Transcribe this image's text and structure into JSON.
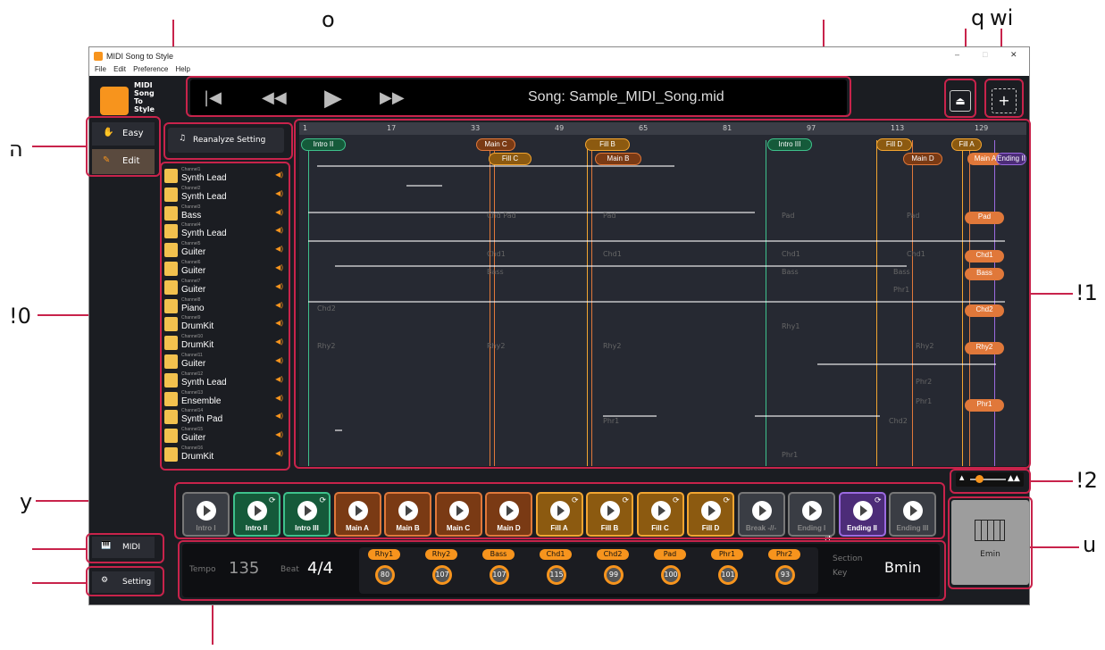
{
  "callouts": {
    "o": "o",
    "q": "q",
    "wi": "wi",
    "he": "ה",
    "one": "!1",
    "zero": "!0",
    "two": "!2",
    "y": "y",
    "u": "u"
  },
  "window": {
    "title": "MIDI Song to Style",
    "menu": [
      "File",
      "Edit",
      "Preference",
      "Help"
    ]
  },
  "logo": {
    "text": "MIDI\nSong\nTo\nStyle"
  },
  "modes": {
    "easy": "Easy",
    "edit": "Edit"
  },
  "transport": {
    "song": "Song: Sample_MIDI_Song.mid"
  },
  "reanalyze": "Reanalyze Setting",
  "ruler": [
    "1",
    "17",
    "33",
    "49",
    "65",
    "81",
    "97",
    "113",
    "129"
  ],
  "tracks": [
    {
      "ch": "Channel1",
      "name": "Synth Lead"
    },
    {
      "ch": "Channel2",
      "name": "Synth Lead"
    },
    {
      "ch": "Channel3",
      "name": "Bass"
    },
    {
      "ch": "Channel4",
      "name": "Synth Lead"
    },
    {
      "ch": "Channel5",
      "name": "Guiter"
    },
    {
      "ch": "Channel6",
      "name": "Guiter"
    },
    {
      "ch": "Channel7",
      "name": "Guiter"
    },
    {
      "ch": "Channel8",
      "name": "Piano"
    },
    {
      "ch": "Channel9",
      "name": "DrumKit"
    },
    {
      "ch": "Channel10",
      "name": "DrumKit"
    },
    {
      "ch": "Channel11",
      "name": "Guiter"
    },
    {
      "ch": "Channel12",
      "name": "Synth Lead"
    },
    {
      "ch": "Channel13",
      "name": "Ensemble"
    },
    {
      "ch": "Channel14",
      "name": "Synth Pad"
    },
    {
      "ch": "Channel15",
      "name": "Guiter"
    },
    {
      "ch": "Channel16",
      "name": "DrumKit"
    }
  ],
  "sections_top": [
    "Intro II",
    "Main C",
    "Fill B",
    "Intro III",
    "Fill D",
    "Fill A"
  ],
  "sections_bottom": [
    "Fill C",
    "Main B",
    "Main D",
    "Main A",
    "Ending II"
  ],
  "lane_tags": [
    "Pad",
    "Chd1",
    "Bass",
    "Chd2",
    "Rhy2",
    "Phr1"
  ],
  "ghost": [
    "Chd Pad",
    "Pad",
    "Pad",
    "Pad",
    "Chd1",
    "Chd1",
    "Chd1",
    "Chd1",
    "Bass",
    "Bass",
    "Phr1",
    "Chd2",
    "Rhy1",
    "Rhy2",
    "Rhy2",
    "Rhy2",
    "Rhy2",
    "Phr2",
    "Phr1",
    "Chd2",
    "Phr1",
    "Phr1",
    "Bass"
  ],
  "sectionButtons": [
    {
      "label": "Intro I",
      "color": "#3a3d44",
      "border": "#777",
      "dim": true,
      "ref": false
    },
    {
      "label": "Intro II",
      "color": "#155a3a",
      "border": "#3ec18c",
      "dim": false,
      "ref": true
    },
    {
      "label": "Intro III",
      "color": "#155a3a",
      "border": "#3ec18c",
      "dim": false,
      "ref": true
    },
    {
      "label": "Main A",
      "color": "#7a3a14",
      "border": "#e0783a",
      "dim": false,
      "ref": false
    },
    {
      "label": "Main B",
      "color": "#7a3a14",
      "border": "#e0783a",
      "dim": false,
      "ref": false
    },
    {
      "label": "Main C",
      "color": "#7a3a14",
      "border": "#e0783a",
      "dim": false,
      "ref": false
    },
    {
      "label": "Main D",
      "color": "#7a3a14",
      "border": "#e0783a",
      "dim": false,
      "ref": false
    },
    {
      "label": "Fill A",
      "color": "#8c5a10",
      "border": "#f2a531",
      "dim": false,
      "ref": true
    },
    {
      "label": "Fill B",
      "color": "#8c5a10",
      "border": "#f2a531",
      "dim": false,
      "ref": true
    },
    {
      "label": "Fill C",
      "color": "#8c5a10",
      "border": "#f2a531",
      "dim": false,
      "ref": true
    },
    {
      "label": "Fill D",
      "color": "#8c5a10",
      "border": "#f2a531",
      "dim": false,
      "ref": true
    },
    {
      "label": "Break -//-",
      "color": "#3a3d44",
      "border": "#777",
      "dim": true,
      "ref": false
    },
    {
      "label": "Ending I",
      "color": "#3a3d44",
      "border": "#777",
      "dim": true,
      "ref": false
    },
    {
      "label": "Ending II",
      "color": "#4c2c78",
      "border": "#9b6ae0",
      "dim": false,
      "ref": true
    },
    {
      "label": "Ending III",
      "color": "#3a3d44",
      "border": "#777",
      "dim": true,
      "ref": false
    }
  ],
  "nav": {
    "midi": "MIDI",
    "setting": "Setting"
  },
  "info": {
    "tempo_label": "Tempo",
    "tempo": "135",
    "beat_label": "Beat",
    "beat": "4/4",
    "section_label": "Section",
    "key_label": "Key",
    "key": "Bmin"
  },
  "parts": [
    {
      "name": "Rhy1",
      "vol": "80"
    },
    {
      "name": "Rhy2",
      "vol": "107"
    },
    {
      "name": "Bass",
      "vol": "107"
    },
    {
      "name": "Chd1",
      "vol": "115"
    },
    {
      "name": "Chd2",
      "vol": "99"
    },
    {
      "name": "Pad",
      "vol": "100"
    },
    {
      "name": "Phr1",
      "vol": "101"
    },
    {
      "name": "Phr2",
      "vol": "93"
    }
  ],
  "chord": {
    "label": "Emin"
  },
  "stray": {
    "rt": "rt"
  }
}
